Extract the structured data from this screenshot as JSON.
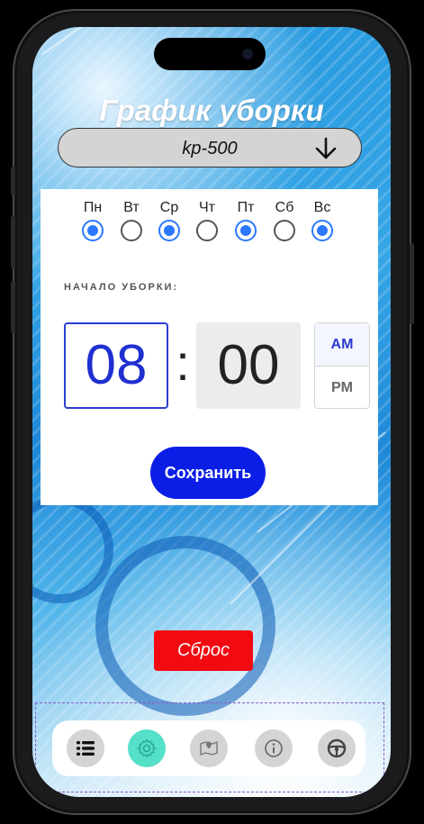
{
  "app": {
    "title": "График уборки"
  },
  "device_select": {
    "value": "kp-500"
  },
  "schedule": {
    "days": [
      {
        "label": "Пн",
        "selected": true
      },
      {
        "label": "Вт",
        "selected": false
      },
      {
        "label": "Ср",
        "selected": true
      },
      {
        "label": "Чт",
        "selected": false
      },
      {
        "label": "Пт",
        "selected": true
      },
      {
        "label": "Сб",
        "selected": false
      },
      {
        "label": "Вс",
        "selected": true
      }
    ],
    "start_label": "НАЧАЛО УБОРКИ:",
    "hour": "08",
    "separator": ":",
    "minute": "00",
    "am_label": "AM",
    "pm_label": "PM",
    "period_selected": "AM",
    "save_label": "Сохранить"
  },
  "reset_label": "Сброс",
  "tabbar": {
    "tabs": [
      {
        "icon": "list-icon",
        "active": false
      },
      {
        "icon": "gear-icon",
        "active": true
      },
      {
        "icon": "map-pin-icon",
        "active": false
      },
      {
        "icon": "info-icon",
        "active": false
      },
      {
        "icon": "steering-wheel-icon",
        "active": false
      }
    ]
  },
  "colors": {
    "accent": "#0b1ee6",
    "radio_selected": "#2b78ff",
    "reset": "#f20a10",
    "active_tab": "#55e0c8"
  }
}
